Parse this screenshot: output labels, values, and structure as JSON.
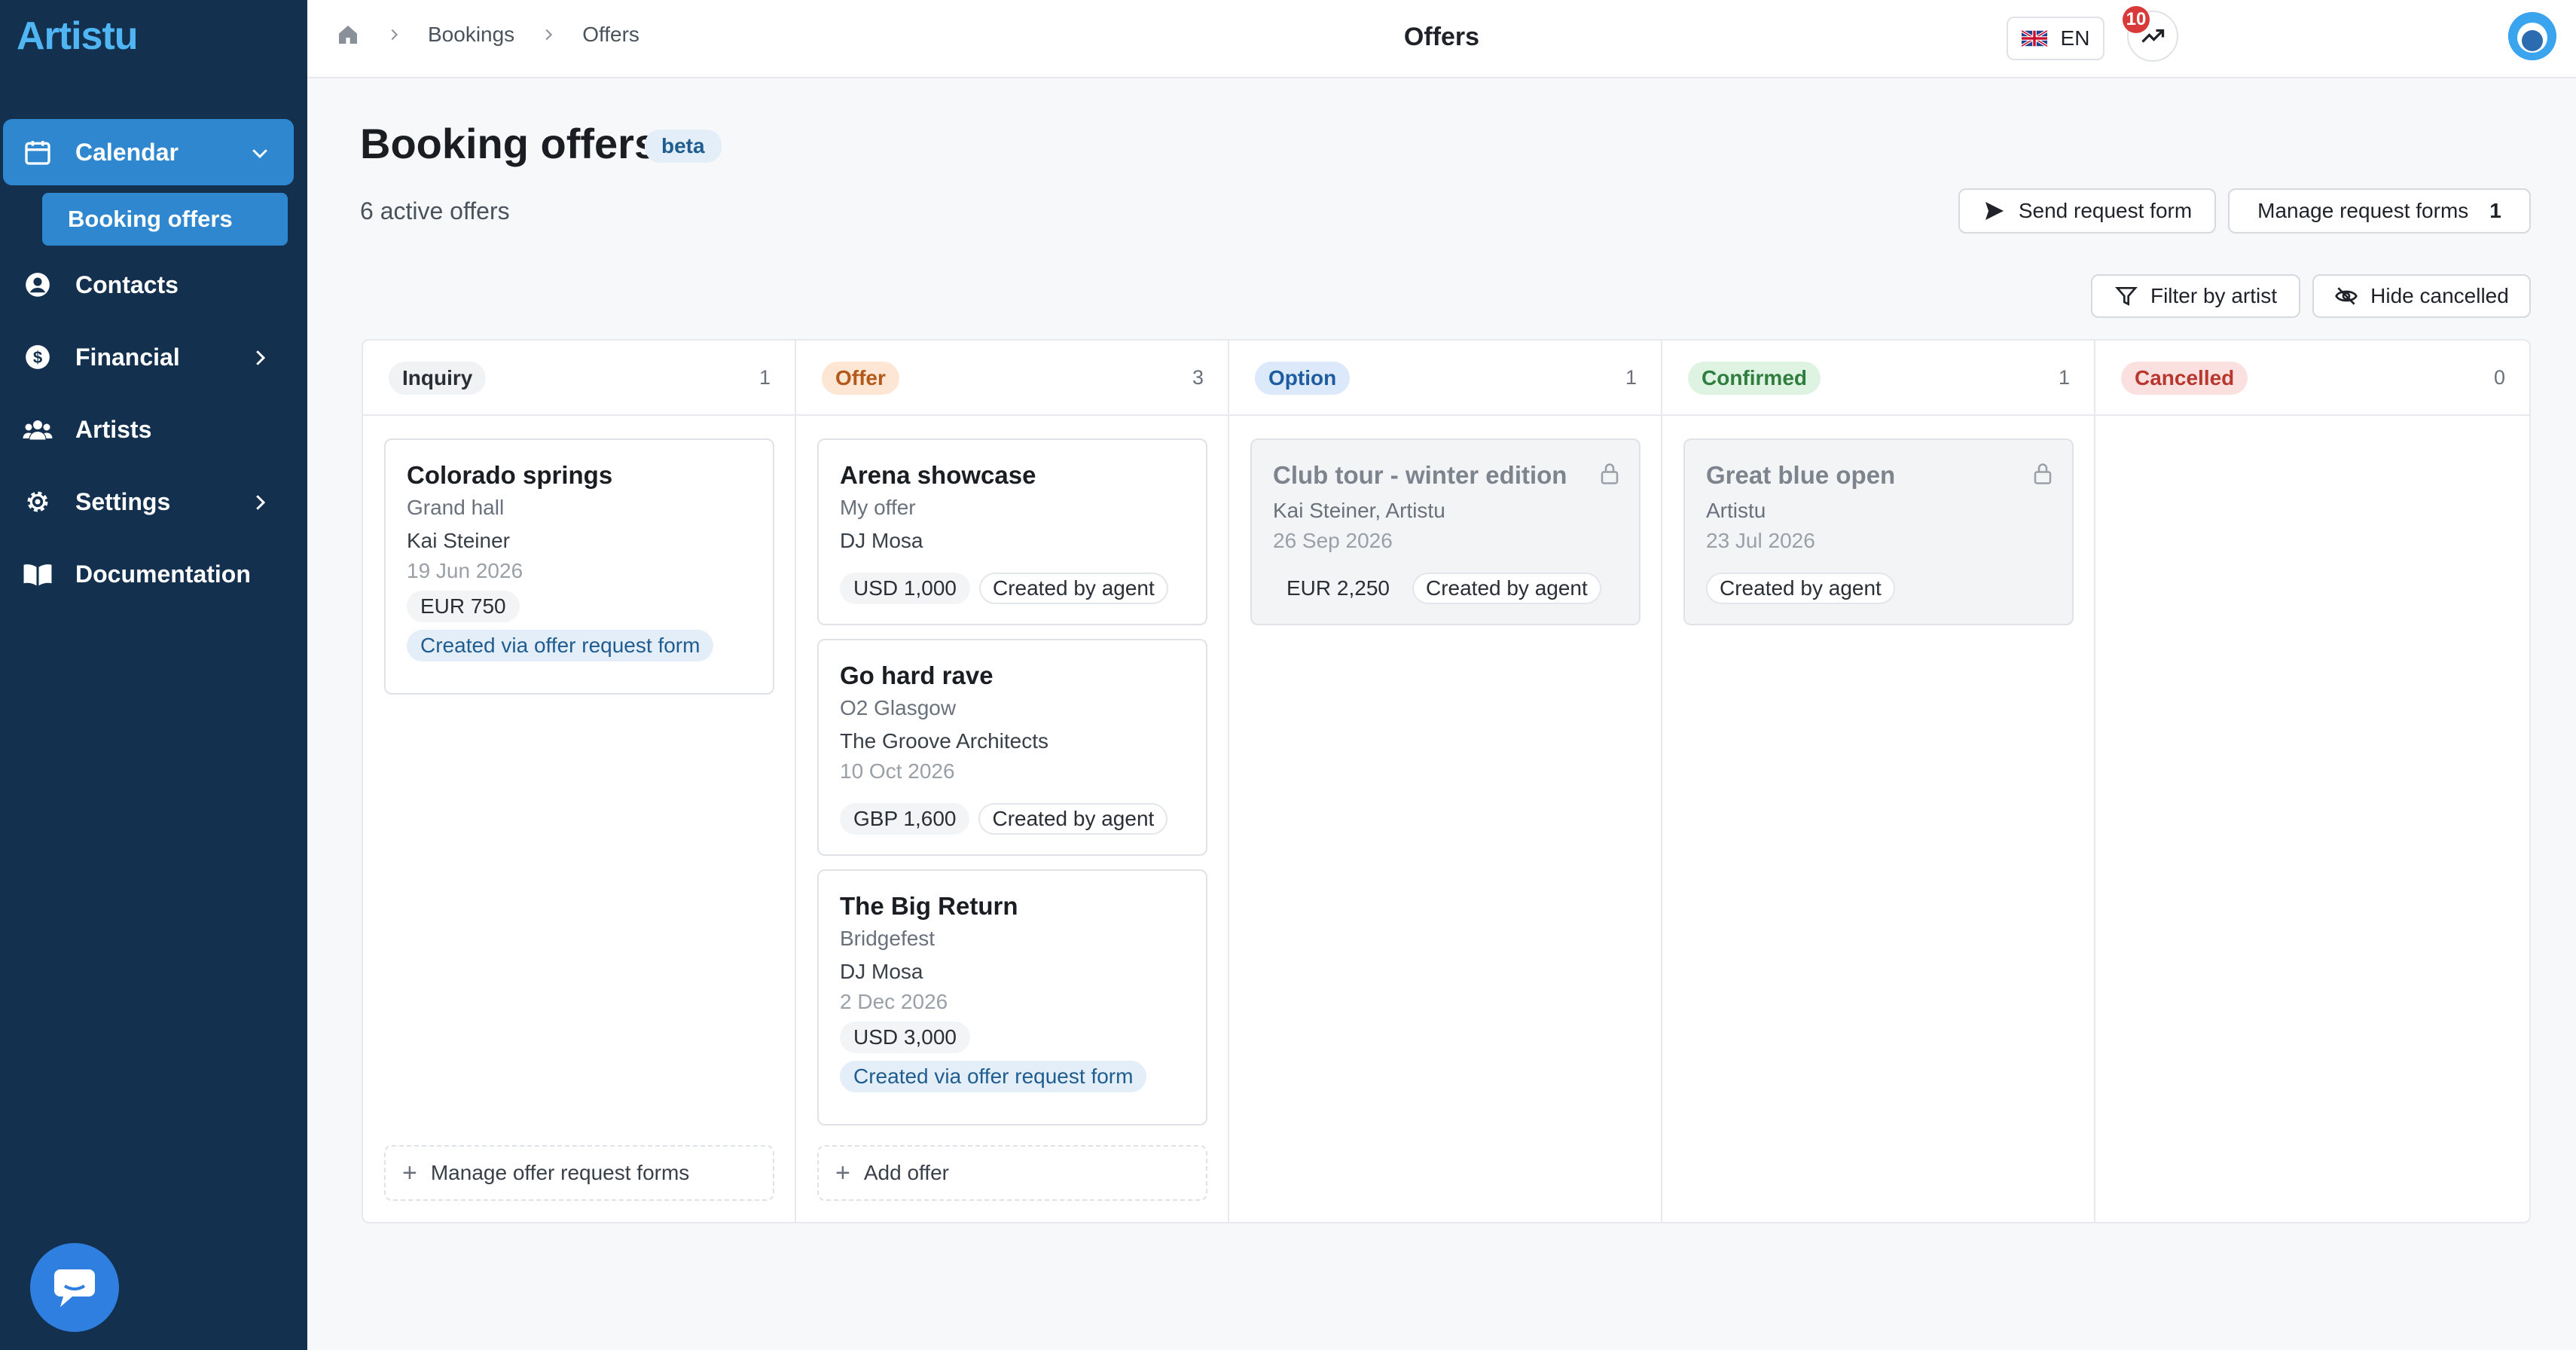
{
  "app": {
    "logo": "Artistu"
  },
  "sidebar": {
    "items": [
      {
        "label": "Calendar"
      },
      {
        "label": "Contacts"
      },
      {
        "label": "Financial"
      },
      {
        "label": "Artists"
      },
      {
        "label": "Settings"
      },
      {
        "label": "Documentation"
      }
    ],
    "sub_item": "Booking offers"
  },
  "topbar": {
    "breadcrumbs": [
      "Bookings",
      "Offers"
    ],
    "title": "Offers",
    "language": "EN",
    "notification_count": "10"
  },
  "page": {
    "title": "Booking offers",
    "badge": "beta",
    "subtitle": "6 active offers",
    "send_request_form": "Send request form",
    "manage_request_forms": "Manage request forms",
    "manage_request_forms_count": "1",
    "filter_by_artist": "Filter by artist",
    "hide_cancelled": "Hide cancelled"
  },
  "board": {
    "columns": [
      {
        "label": "Inquiry",
        "count": "1",
        "cards": [
          {
            "title": "Colorado springs",
            "venue": "Grand hall",
            "artist": "Kai Steiner",
            "date": "19 Jun 2026",
            "amount": "EUR 750",
            "info": "Created via offer request form"
          }
        ],
        "footer": "Manage offer request forms"
      },
      {
        "label": "Offer",
        "count": "3",
        "cards": [
          {
            "title": "Arena showcase",
            "venue": "My offer",
            "artist": "DJ Mosa",
            "amount": "USD 1,000",
            "tag": "Created by agent"
          },
          {
            "title": "Go hard rave",
            "venue": "O2 Glasgow",
            "artist": "The Groove Architects",
            "date": "10 Oct 2026",
            "amount": "GBP 1,600",
            "tag": "Created by agent"
          },
          {
            "title": "The Big Return",
            "venue": "Bridgefest",
            "artist": "DJ Mosa",
            "date": "2 Dec 2026",
            "amount": "USD 3,000",
            "info": "Created via offer request form"
          }
        ],
        "footer": "Add offer"
      },
      {
        "label": "Option",
        "count": "1",
        "cards": [
          {
            "title": "Club tour - winter edition",
            "artist": "Kai Steiner, Artistu",
            "date": "26 Sep 2026",
            "amount": "EUR 2,250",
            "tag": "Created by agent"
          }
        ]
      },
      {
        "label": "Confirmed",
        "count": "1",
        "cards": [
          {
            "title": "Great blue open",
            "artist": "Artistu",
            "date": "23 Jul 2026",
            "tag": "Created by agent"
          }
        ]
      },
      {
        "label": "Cancelled",
        "count": "0",
        "cards": []
      }
    ]
  },
  "colors": {
    "sidebar_bg": "#14304f",
    "accent": "#2f88cf",
    "inquiry": "#f1f2f4",
    "offer": "#fde6d4",
    "option": "#dbe9fb",
    "confirmed": "#dff3e3",
    "cancelled": "#fbe0e0"
  },
  "icons": [
    "home-icon",
    "calendar-icon",
    "contacts-icon",
    "financial-icon",
    "artists-icon",
    "settings-icon",
    "documentation-icon",
    "chevron-down-icon",
    "chevron-right-icon",
    "send-icon",
    "filter-icon",
    "eye-off-icon",
    "lock-icon",
    "plus-icon",
    "trend-icon",
    "chat-icon",
    "uk-flag-icon"
  ]
}
